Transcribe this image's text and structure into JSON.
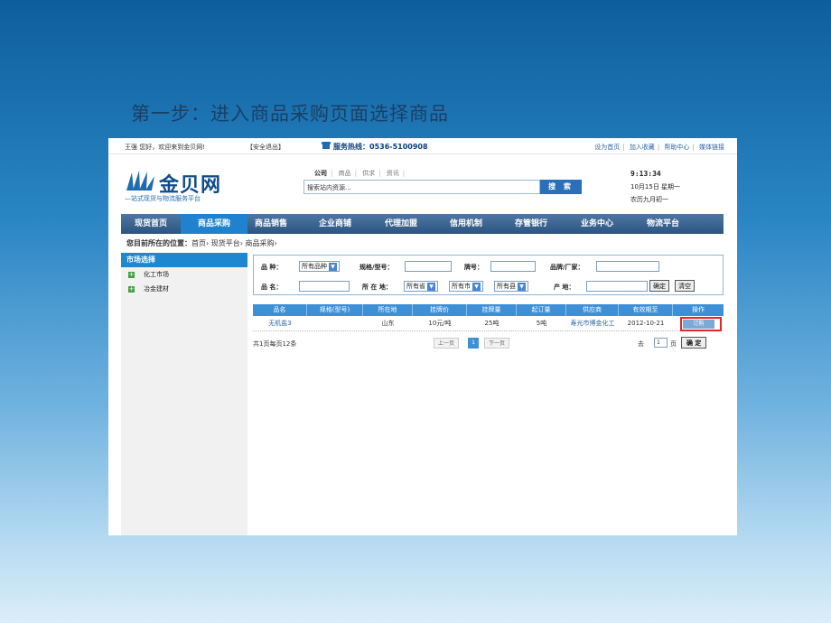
{
  "slide": {
    "title": "第一步：进入商品采购页面选择商品"
  },
  "topbar": {
    "greeting": "王强 您好，欢迎来到金贝网!",
    "logout": "【安全退出】",
    "hotline": "服务热线：0536-5100908",
    "links": [
      "设为首页",
      "加入收藏",
      "帮助中心",
      "媒体链接"
    ]
  },
  "logo": {
    "name": "金贝网",
    "slogan": "—站式现货与物流服务平台"
  },
  "search": {
    "tabs": [
      "公司",
      "商品",
      "供求",
      "资讯"
    ],
    "active_tab": "公司",
    "placeholder": "搜索站内资源...",
    "button": "搜 索"
  },
  "clock": {
    "time": "9:13:34",
    "date": "10月15日 星期一",
    "lunar": "农历九月初一"
  },
  "nav": {
    "items": [
      "现货首页",
      "商品采购",
      "商品销售",
      "企业商铺",
      "代理加盟",
      "信用机制",
      "存管银行",
      "业务中心",
      "物流平台"
    ],
    "active": "商品采购"
  },
  "breadcrumb": {
    "label": "您目前所在的位置：",
    "path": "首页› 现货平台› 商品采购›"
  },
  "sidebar": {
    "title": "市场选择",
    "items": [
      "化工市场",
      "冶金建材"
    ]
  },
  "filters": {
    "variety_label": "品  种：",
    "variety_value": "所有品种",
    "spec_label": "规格/型号：",
    "brand_label": "牌号：",
    "maker_label": "品牌/厂家：",
    "name_label": "品  名：",
    "location_label": "所 在 地：",
    "province": "所有省",
    "city": "所有市",
    "county": "所有县",
    "origin_label": "产  地：",
    "confirm": "确定",
    "clear": "清空"
  },
  "table": {
    "headers": [
      "品名",
      "规格(型号)",
      "所在地",
      "挂牌价",
      "挂牌量",
      "起订量",
      "供应商",
      "有效期至",
      "操作"
    ],
    "rows": [
      {
        "name": "无机盐3",
        "spec": "",
        "location": "山东",
        "price": "10元/吨",
        "qty": "25吨",
        "min": "5吨",
        "supplier": "寿光市博金化工",
        "expiry": "2012-10-21",
        "action": "订购"
      }
    ]
  },
  "pager": {
    "summary": "共1页每页12条",
    "prev": "上一页",
    "current": "1",
    "next": "下一页",
    "goto_label": "去",
    "goto_value": "1",
    "page_unit": "页",
    "confirm": "确 定"
  },
  "colors": {
    "accent": "#1f86d0",
    "nav": "#2c5481",
    "highlight": "#e2262a"
  }
}
